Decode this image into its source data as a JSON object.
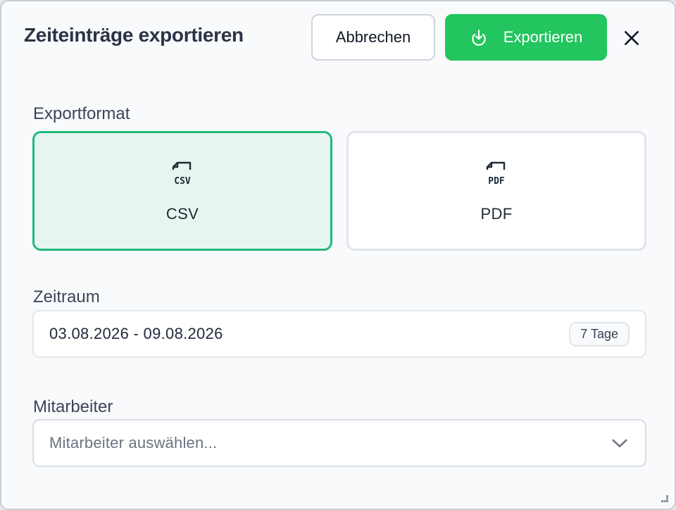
{
  "dialog": {
    "title": "Zeiteinträge exportieren",
    "cancel_label": "Abbrechen",
    "export_label": "Exportieren",
    "close_icon": "close-icon"
  },
  "format": {
    "label": "Exportformat",
    "options": [
      {
        "id": "csv",
        "label": "CSV",
        "icon_text": "CSV",
        "icon": "csv-file-icon",
        "selected": true
      },
      {
        "id": "pdf",
        "label": "PDF",
        "icon_text": "PDF",
        "icon": "pdf-file-icon",
        "selected": false
      }
    ]
  },
  "period": {
    "label": "Zeitraum",
    "value": "03.08.2026 - 09.08.2026",
    "badge": "7 Tage"
  },
  "employees": {
    "label": "Mitarbeiter",
    "placeholder": "Mitarbeiter auswählen...",
    "chevron_icon": "chevron-down-icon"
  },
  "colors": {
    "accent": "#22c55e",
    "selected_border": "#22b97a",
    "selected_bg": "#e6f5ef"
  }
}
